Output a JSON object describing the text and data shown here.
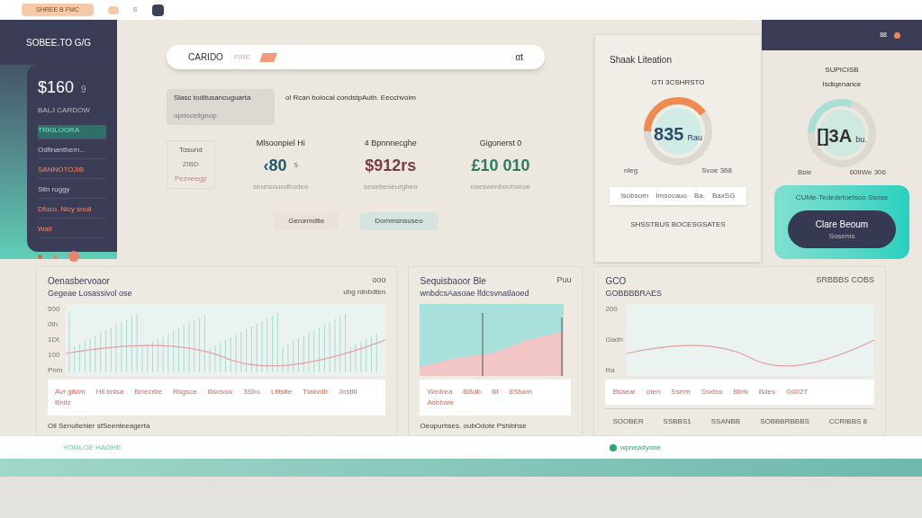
{
  "browser": {
    "tab": "SHREE B FMC",
    "tab_count": "S"
  },
  "brand": "SOBEE.TO G/G",
  "sidebar": {
    "balance": "$160",
    "balance_unit": "9",
    "caption": "BALJ CARDOW",
    "items": [
      {
        "label": "TRKILOGRA",
        "selected": true,
        "kind": "teal"
      },
      {
        "label": "Odfinanthern...",
        "selected": false,
        "kind": "plain"
      },
      {
        "label": "SANNOTOJIB",
        "selected": false,
        "kind": "accent"
      },
      {
        "label": "Siln ruggy",
        "selected": false,
        "kind": "plain"
      },
      {
        "label": "Dfuco. Nicy snull",
        "selected": false,
        "kind": "accent"
      },
      {
        "label": "Wait",
        "selected": false,
        "kind": "accent"
      }
    ]
  },
  "search": {
    "value": "CARIDO",
    "tag": "FIRE",
    "action": "αt"
  },
  "notice": {
    "title": "Slasc toditusancuguarta",
    "subtitle": "opriocellgnop",
    "text": "ol Rcan bolocal condstpAuth. Eecchvoim"
  },
  "side_stat": {
    "label": "Tosund",
    "value": "ZIBD",
    "note": "Pezveegp"
  },
  "kpis": [
    {
      "label": "Mlsoonpiel Hi",
      "value": "‹80",
      "badge": "s",
      "note": "seunsouodbodeo",
      "color": "#1d5a6a"
    },
    {
      "label": "4 Bpnnnecghe",
      "value": "$912rs",
      "note": "sesebeoeurgbeo",
      "color": "#7a3a48"
    },
    {
      "label": "Gigonerst 0",
      "value": "£10 010",
      "note": "oseswenboohseoe",
      "color": "#2f7a64"
    }
  ],
  "buttons": [
    {
      "label": "Gerormdtie",
      "selected": false
    },
    {
      "label": "Dommsnsuseo",
      "selected": true
    }
  ],
  "gauge_card": {
    "title": "Shaak Liteation",
    "caption": "GTI 3CSHRSTO",
    "value": "835",
    "unit": "Rau",
    "left": "nleg",
    "right": "Svoe 368",
    "strip": [
      "Isobsorn",
      "Imsocauo",
      "Ba.",
      "BaxSG"
    ],
    "footer": "SHSSTBUS BOCESGSATES"
  },
  "right_panel": {
    "header_text": "88",
    "label": "SUPICISB",
    "gauge_caption": "Isdiqenance",
    "value": "[]3A",
    "unit": "bu.",
    "left": "Bsie",
    "right": "60tiWe 306",
    "promo": "CUMe-Tededefoetsoo Ssnse",
    "button": "Clare Beoum",
    "button_sub": "Sosems"
  },
  "charts": [
    {
      "title": "Oenasbervoaor",
      "subtitle": "Gegeae Losassivol ose",
      "legend": "ooo",
      "legend_sub": "ubg rdnbdten",
      "yaxis": [
        "500",
        "0th",
        "1Dt",
        "100",
        "Pnm"
      ],
      "labels": [
        "Avr gitdm",
        "Hll bnlsa",
        "Brrecrbe",
        "Rsgsce",
        "Bsxsow",
        "3Sbo",
        "Lfitstie",
        "Tlakvdlr",
        "Jnstitl",
        "Bnitz"
      ],
      "footer": "Oll Senultehier sfSeenteeagerta"
    },
    {
      "title": "Sequisbaoor Ble",
      "subtitle": "wnbdcsAasoae lfdcsvnatlaoed",
      "legend": "Puu",
      "labels": [
        "Wedrea",
        "BBdb",
        "Bf",
        "8Sbam",
        "Asbbare"
      ],
      "footer": "Oeopurhses. oubOdote Pshibhse"
    },
    {
      "title": "GCO",
      "subtitle": "GOBBBBRAES",
      "legend": "SRBBBS COBS",
      "yaxis": [
        "200",
        "Gadh",
        "Ra"
      ],
      "labels": [
        "Bsaear",
        "oten",
        "Ssrrm",
        "Ssxtss",
        "Bbrk",
        "Bdes",
        "G0027"
      ],
      "axis": [
        "SOOBER",
        "SSBBS1",
        "SSANBB",
        "SOBBBRBBBS",
        "CCRIBBS 8"
      ]
    }
  ],
  "status_bar": {
    "left": "YOGLOE HAOHE",
    "right": "wpneadyone"
  }
}
